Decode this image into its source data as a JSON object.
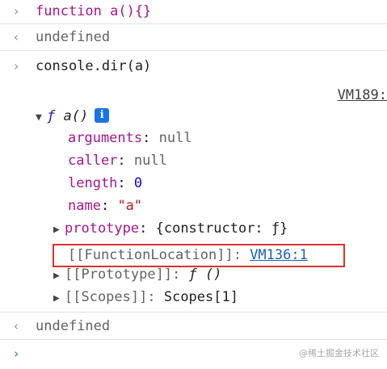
{
  "console": {
    "entry1": {
      "input": "function a(){}",
      "output": "undefined"
    },
    "entry2": {
      "input": "console.dir(a)",
      "source_link": "VM189:",
      "object": {
        "header_f": "ƒ",
        "header_name": "a()",
        "info_badge": "i",
        "props": {
          "arguments": {
            "key": "arguments",
            "value": "null"
          },
          "caller": {
            "key": "caller",
            "value": "null"
          },
          "length": {
            "key": "length",
            "value": "0"
          },
          "name": {
            "key": "name",
            "value": "\"a\""
          },
          "prototype": {
            "key": "prototype",
            "value": "{constructor: ƒ}"
          },
          "function_location": {
            "key": "[[FunctionLocation]]",
            "value": "VM136:1"
          },
          "proto": {
            "key": "[[Prototype]]",
            "value": "ƒ ()"
          },
          "scopes": {
            "key": "[[Scopes]]",
            "value": "Scopes[1]"
          }
        }
      },
      "output": "undefined"
    }
  },
  "glyphs": {
    "input_prompt": "›",
    "return_arrow": "‹",
    "collapsed": "▶",
    "expanded": "▼"
  },
  "watermark": "@稀土掘金技术社区"
}
